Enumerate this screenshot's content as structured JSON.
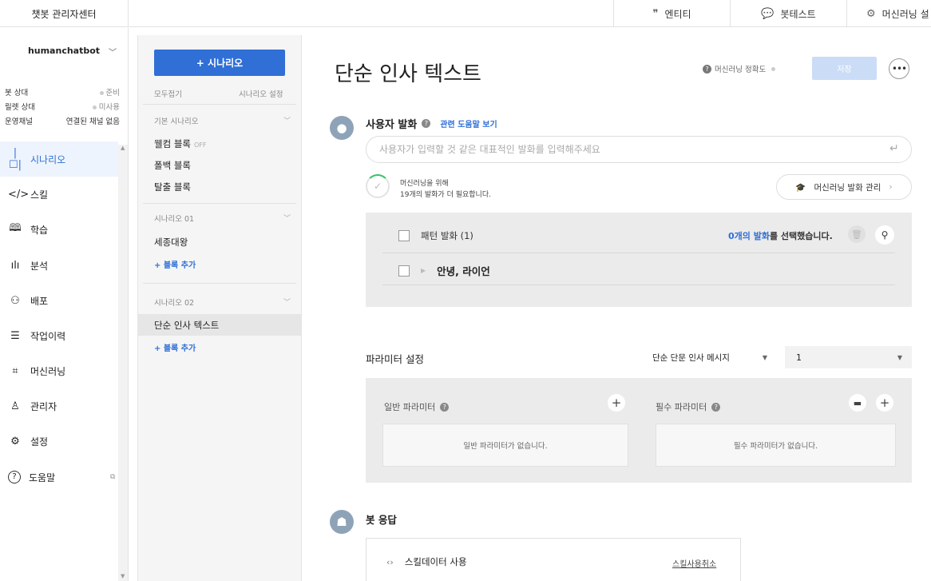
{
  "app_title": "챗봇 관리자센터",
  "topnav": [
    {
      "label": "엔티티",
      "icon": "quote-icon"
    },
    {
      "label": "봇테스트",
      "icon": "chat-bubble-icon"
    },
    {
      "label": "머신러닝 설",
      "icon": "chip-icon"
    }
  ],
  "bot": {
    "name": "humanchatbot",
    "status": [
      {
        "label": "봇 상대",
        "value": "준비"
      },
      {
        "label": "릴렛 상대",
        "value": "미사용"
      },
      {
        "label": "운영채널",
        "value": "연결된 채널 없음"
      }
    ]
  },
  "nav": [
    {
      "label": "시나리오",
      "icon": "scenario-icon",
      "glyph": "|☐|",
      "active": true
    },
    {
      "label": "스킬",
      "icon": "code-icon",
      "glyph": "</>"
    },
    {
      "label": "학습",
      "icon": "book-icon",
      "glyph": "🕮"
    },
    {
      "label": "분석",
      "icon": "bar-chart-icon",
      "glyph": "ılı"
    },
    {
      "label": "배포",
      "icon": "deploy-icon",
      "glyph": "⚇"
    },
    {
      "label": "작업이력",
      "icon": "history-icon",
      "glyph": "☰"
    },
    {
      "label": "머신러닝",
      "icon": "chip-icon",
      "glyph": "⌗"
    },
    {
      "label": "관리자",
      "icon": "admin-icon",
      "glyph": "♙"
    },
    {
      "label": "설정",
      "icon": "gear-icon",
      "glyph": "⚙"
    },
    {
      "label": "도움말",
      "icon": "help-icon",
      "glyph": "?"
    }
  ],
  "scenario_panel": {
    "add_label": "+ 시나리오",
    "collapse_all": "모두접기",
    "settings": "시나리오 설정",
    "groups": [
      {
        "title": "기본 시나리오",
        "blocks": [
          "웰컴 블록",
          "폴백 블록",
          "탈출 블록"
        ],
        "welcome_badge": "OFF"
      },
      {
        "title": "시나리오 01",
        "blocks": [
          "세종대왕"
        ],
        "add": "+ 블록 추가"
      },
      {
        "title": "시나리오 02",
        "blocks": [
          "단순 인사 텍스트"
        ],
        "add": "+ 블록 추가"
      }
    ]
  },
  "main": {
    "title": "단순 인사 텍스트",
    "ml_accuracy": "머신러닝 정확도",
    "save": "저장",
    "more": "•••",
    "utterance": {
      "title": "사용자 발화",
      "help_link": "관련 도움말 보기",
      "placeholder": "사용자가 입력할 것 같은 대표적인 발화를 입력해주세요",
      "ml_need_line1": "머신러닝을 위해",
      "ml_need_line2": "19개의 발화가 더 필요합니다.",
      "ml_manage": "머신러닝 발화 관리"
    },
    "pattern": {
      "header": "패턴 발화 (1)",
      "selected_count": "0개의 발화",
      "selected_suffix": "를 선택했습니다.",
      "rows": [
        "안녕, 라이언"
      ]
    },
    "params": {
      "title": "파라미터 설정",
      "dropdown1": "단순 단문 인사 메시지",
      "dropdown2": "1",
      "general_title": "일반 파라미터",
      "general_empty": "일반 파라미터가 없습니다.",
      "required_title": "필수 파라미터",
      "required_empty": "필수 파라미터가 없습니다."
    },
    "bot_response": {
      "title": "봇 응답",
      "skill_label": "스킬데이터 사용",
      "skill_cancel": "스킬사용취소"
    }
  }
}
